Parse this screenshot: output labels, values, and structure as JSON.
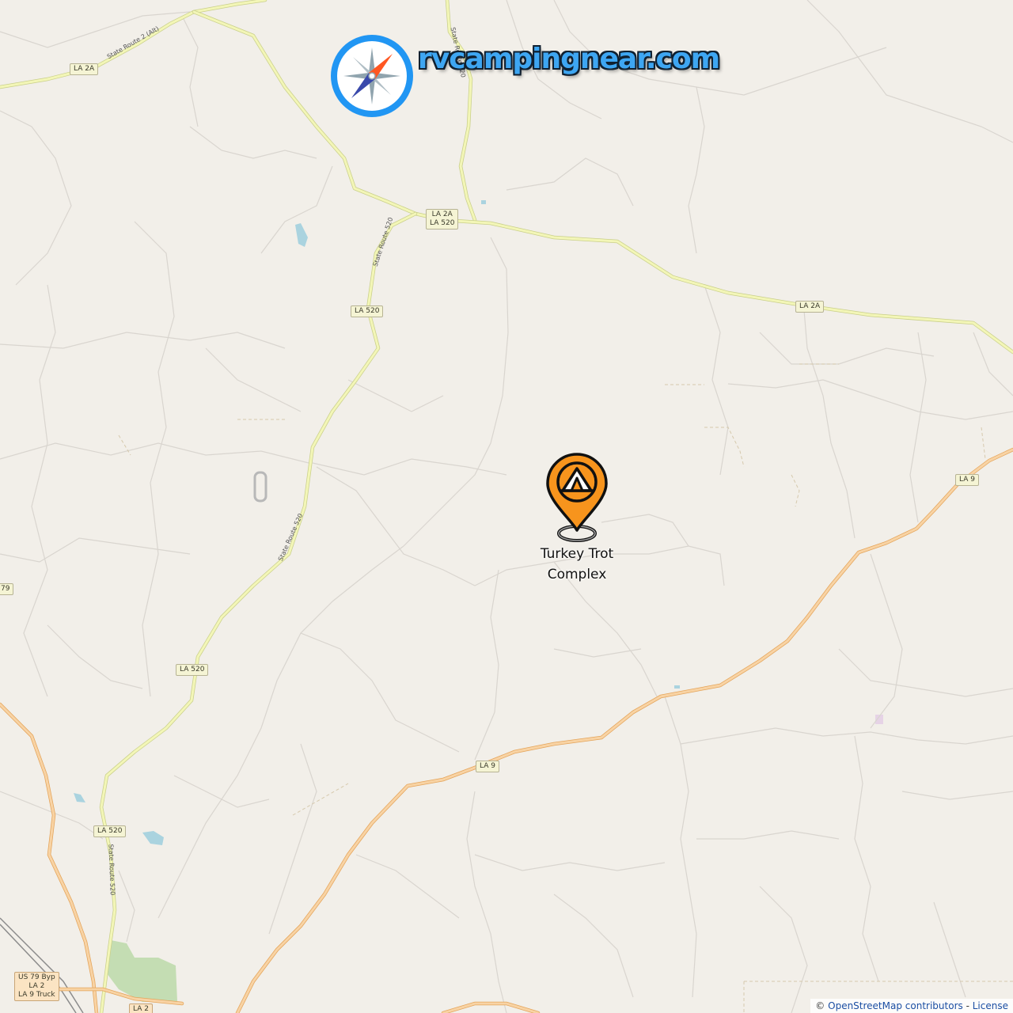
{
  "map": {
    "site_logo_text": "rvcampingnear.com",
    "site_logo_icon": "compass-icon",
    "marker": {
      "icon": "tent-location-pin-icon",
      "label": "Turkey Trot Complex",
      "color": "#f7941d"
    },
    "road_shields": [
      {
        "text": "LA 2A",
        "kind": "state"
      },
      {
        "text": "LA 2A\nLA 520",
        "kind": "state"
      },
      {
        "text": "LA 520",
        "kind": "state"
      },
      {
        "text": "LA 2A",
        "kind": "state"
      },
      {
        "text": "LA 9",
        "kind": "state"
      },
      {
        "text": "79",
        "kind": "state"
      },
      {
        "text": "LA 520",
        "kind": "state"
      },
      {
        "text": "LA 9",
        "kind": "state"
      },
      {
        "text": "LA 520",
        "kind": "state"
      },
      {
        "text": "US 79 Byp\nLA 2\nLA 9 Truck",
        "kind": "us"
      },
      {
        "text": "LA 2",
        "kind": "us"
      }
    ],
    "road_names": [
      "State Route 2 (Alt)",
      "State Route 520",
      "State Route 520",
      "State Route 520",
      "State Route 520"
    ],
    "colors": {
      "background": "#f2efe9",
      "secondary_road": "#f3f6b7",
      "primary_road": "#f8d3a4",
      "water": "#aad3df",
      "park": "#c4ddb3",
      "logo_blue": "#3ea6f2"
    }
  },
  "attribution": {
    "prefix": "©",
    "osm_link": "OpenStreetMap contributors",
    "separator": "-",
    "license_link": "License"
  }
}
